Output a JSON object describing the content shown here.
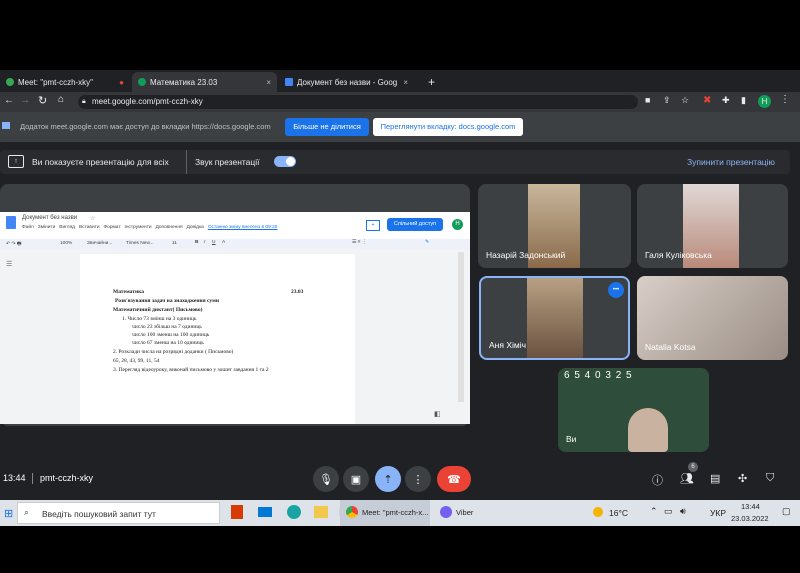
{
  "tabs": [
    {
      "title": "Meet: \"pmt-cczh-xky\"",
      "close": "×"
    },
    {
      "title": "Математика 23.03",
      "close": "×"
    },
    {
      "title": "Документ без назви - Goog",
      "close": "×"
    }
  ],
  "new_tab": "+",
  "address": "meet.google.com/pmt-cczh-xky",
  "profile_initial": "H",
  "share_bar": {
    "message": "Додаток meet.google.com має доступ до вкладки https://docs.google.com",
    "stop_label": "Більше не ділитися",
    "view_label": "Переглянути вкладку: docs.google.com"
  },
  "presentation": {
    "status": "Ви показуєте презентацію для всіх",
    "sound_label": "Звук презентації",
    "stop_label": "Зупинити презентацію"
  },
  "doc": {
    "title": "Документ без назви",
    "menu": [
      "Файл",
      "Змінити",
      "Вигляд",
      "Вставити",
      "Формат",
      "Інструменти",
      "Доповнення",
      "Довідка"
    ],
    "last_edit": "Останню зміну внесено в 09:20",
    "share_btn": "Спільний доступ",
    "zoom": "100%",
    "style": "Звичайни...",
    "font": "Times New...",
    "font_size": "11",
    "header_left": "Математика",
    "header_right": "23.03",
    "line1": "Розв'язування задач на знаходження суми",
    "line2": "Математичний диктант( Письмово)",
    "item1": "1.  Число 73 змінш на 3 одиниць",
    "item1b": "число 23 збільш на 7 одиниць",
    "item1c": "число 100 зменш на 100 одиниць",
    "item1d": "число 67 зменш на 10 одиниць",
    "item2": "2. Розклади числа на розрядні доданки ( Письмово)",
    "item2b": "65, 28, 43, 99, 11, 54",
    "item3": "3. Перегляд відеоуроку, виконай письмово у зошит завдання 1 та 2"
  },
  "participants": [
    {
      "name": "Назарій Задонський"
    },
    {
      "name": "Галя Куліковська"
    },
    {
      "name": "Аня Хіміч"
    },
    {
      "name": "Natalia Kotsa"
    },
    {
      "name": "Ви"
    }
  ],
  "board_digits": "6 5 4 0 3 2 5",
  "more_icon": "•••",
  "meeting": {
    "time": "13:44",
    "code": "pmt-cczh-xky",
    "people_count": "6"
  },
  "taskbar": {
    "search_placeholder": "Введіть пошуковий запит тут",
    "app_meet": "Meet: \"pmt-cczh-x...",
    "app_viber": "Viber",
    "temperature": "16°C",
    "lang": "УКР",
    "clock_time": "13:44",
    "clock_date": "23.03.2022"
  },
  "colors": {
    "accent": "#8ab4f8",
    "hangup": "#ea4335",
    "present": "#8ab4f8",
    "share_btn": "#1a73e8"
  }
}
